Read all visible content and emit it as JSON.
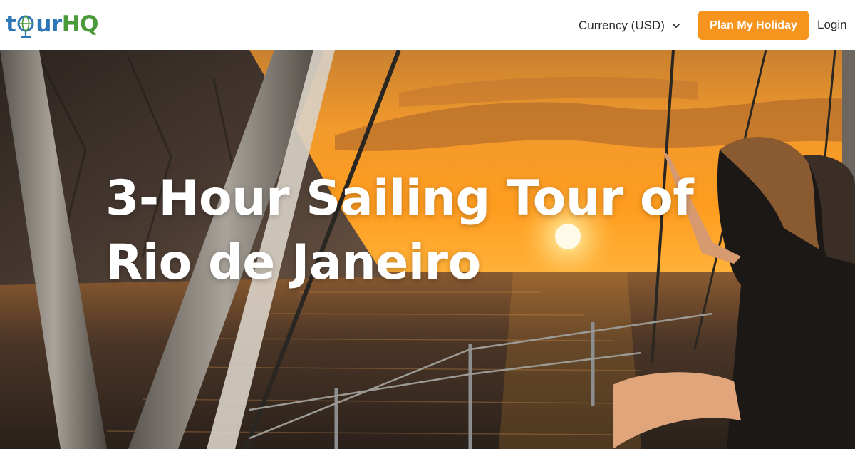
{
  "header": {
    "logo": {
      "text_part1": "t",
      "text_part2": "ur",
      "text_part3": "HQ",
      "brand_color_blue": "#2e77b7",
      "brand_color_green": "#4a9a3a"
    },
    "currency": {
      "label": "Currency (USD)",
      "icon": "chevron-down-icon"
    },
    "cta_button": {
      "label": "Plan My Holiday",
      "color": "#f7941d"
    },
    "login": {
      "label": "Login"
    }
  },
  "hero": {
    "title": "3-Hour Sailing Tour of Rio de Janeiro",
    "image_alt": "sunset-sailboat-photo"
  }
}
